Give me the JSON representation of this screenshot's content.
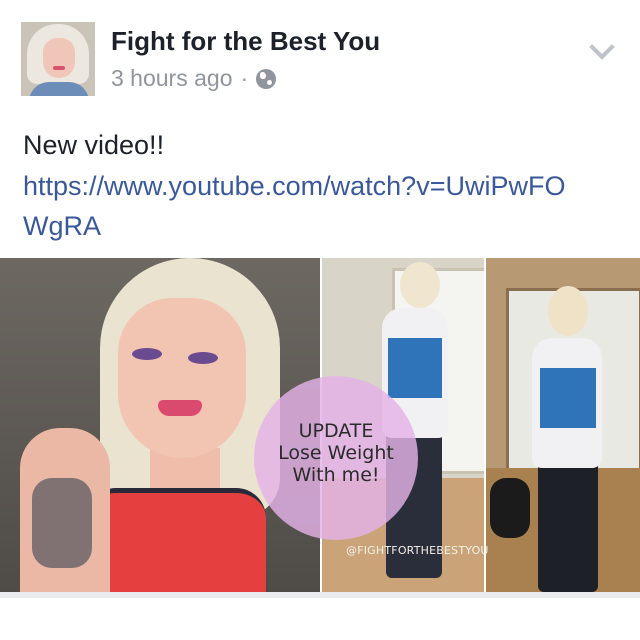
{
  "post": {
    "page_name": "Fight for the Best You",
    "timestamp": "3 hours ago",
    "separator": "·",
    "privacy_icon": "globe-icon",
    "menu_icon": "chevron-down-icon",
    "text": "New video!!",
    "link": "https://www.youtube.com/watch?v=UwiPwFOWgRA"
  },
  "media": {
    "overlay_line1": "UPDATE",
    "overlay_line2": "Lose Weight With me!",
    "watermark": "@FIGHTFORTHEBESTYOU"
  },
  "colors": {
    "background": "#e9ebee",
    "text": "#1d2129",
    "meta": "#90949c",
    "link": "#3b5998",
    "overlay_circle": "#e4b2e8"
  }
}
